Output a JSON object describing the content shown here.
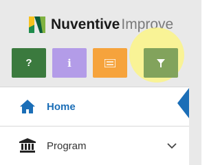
{
  "brand": {
    "name": "Nuventive",
    "product": "Improve"
  },
  "toolbar": {
    "help": {
      "label": "?",
      "color": "#3b7a3e"
    },
    "info": {
      "label": "i",
      "color": "#b39ce8"
    },
    "notes": {
      "icon": "list-icon",
      "color": "#f6a33c"
    },
    "filter": {
      "icon": "filter-icon",
      "color": "#82a35c"
    }
  },
  "nav": {
    "home": {
      "label": "Home",
      "icon": "home-icon"
    },
    "program": {
      "label": "Program",
      "icon": "building-icon",
      "chevron": "chevron-down-icon"
    }
  }
}
